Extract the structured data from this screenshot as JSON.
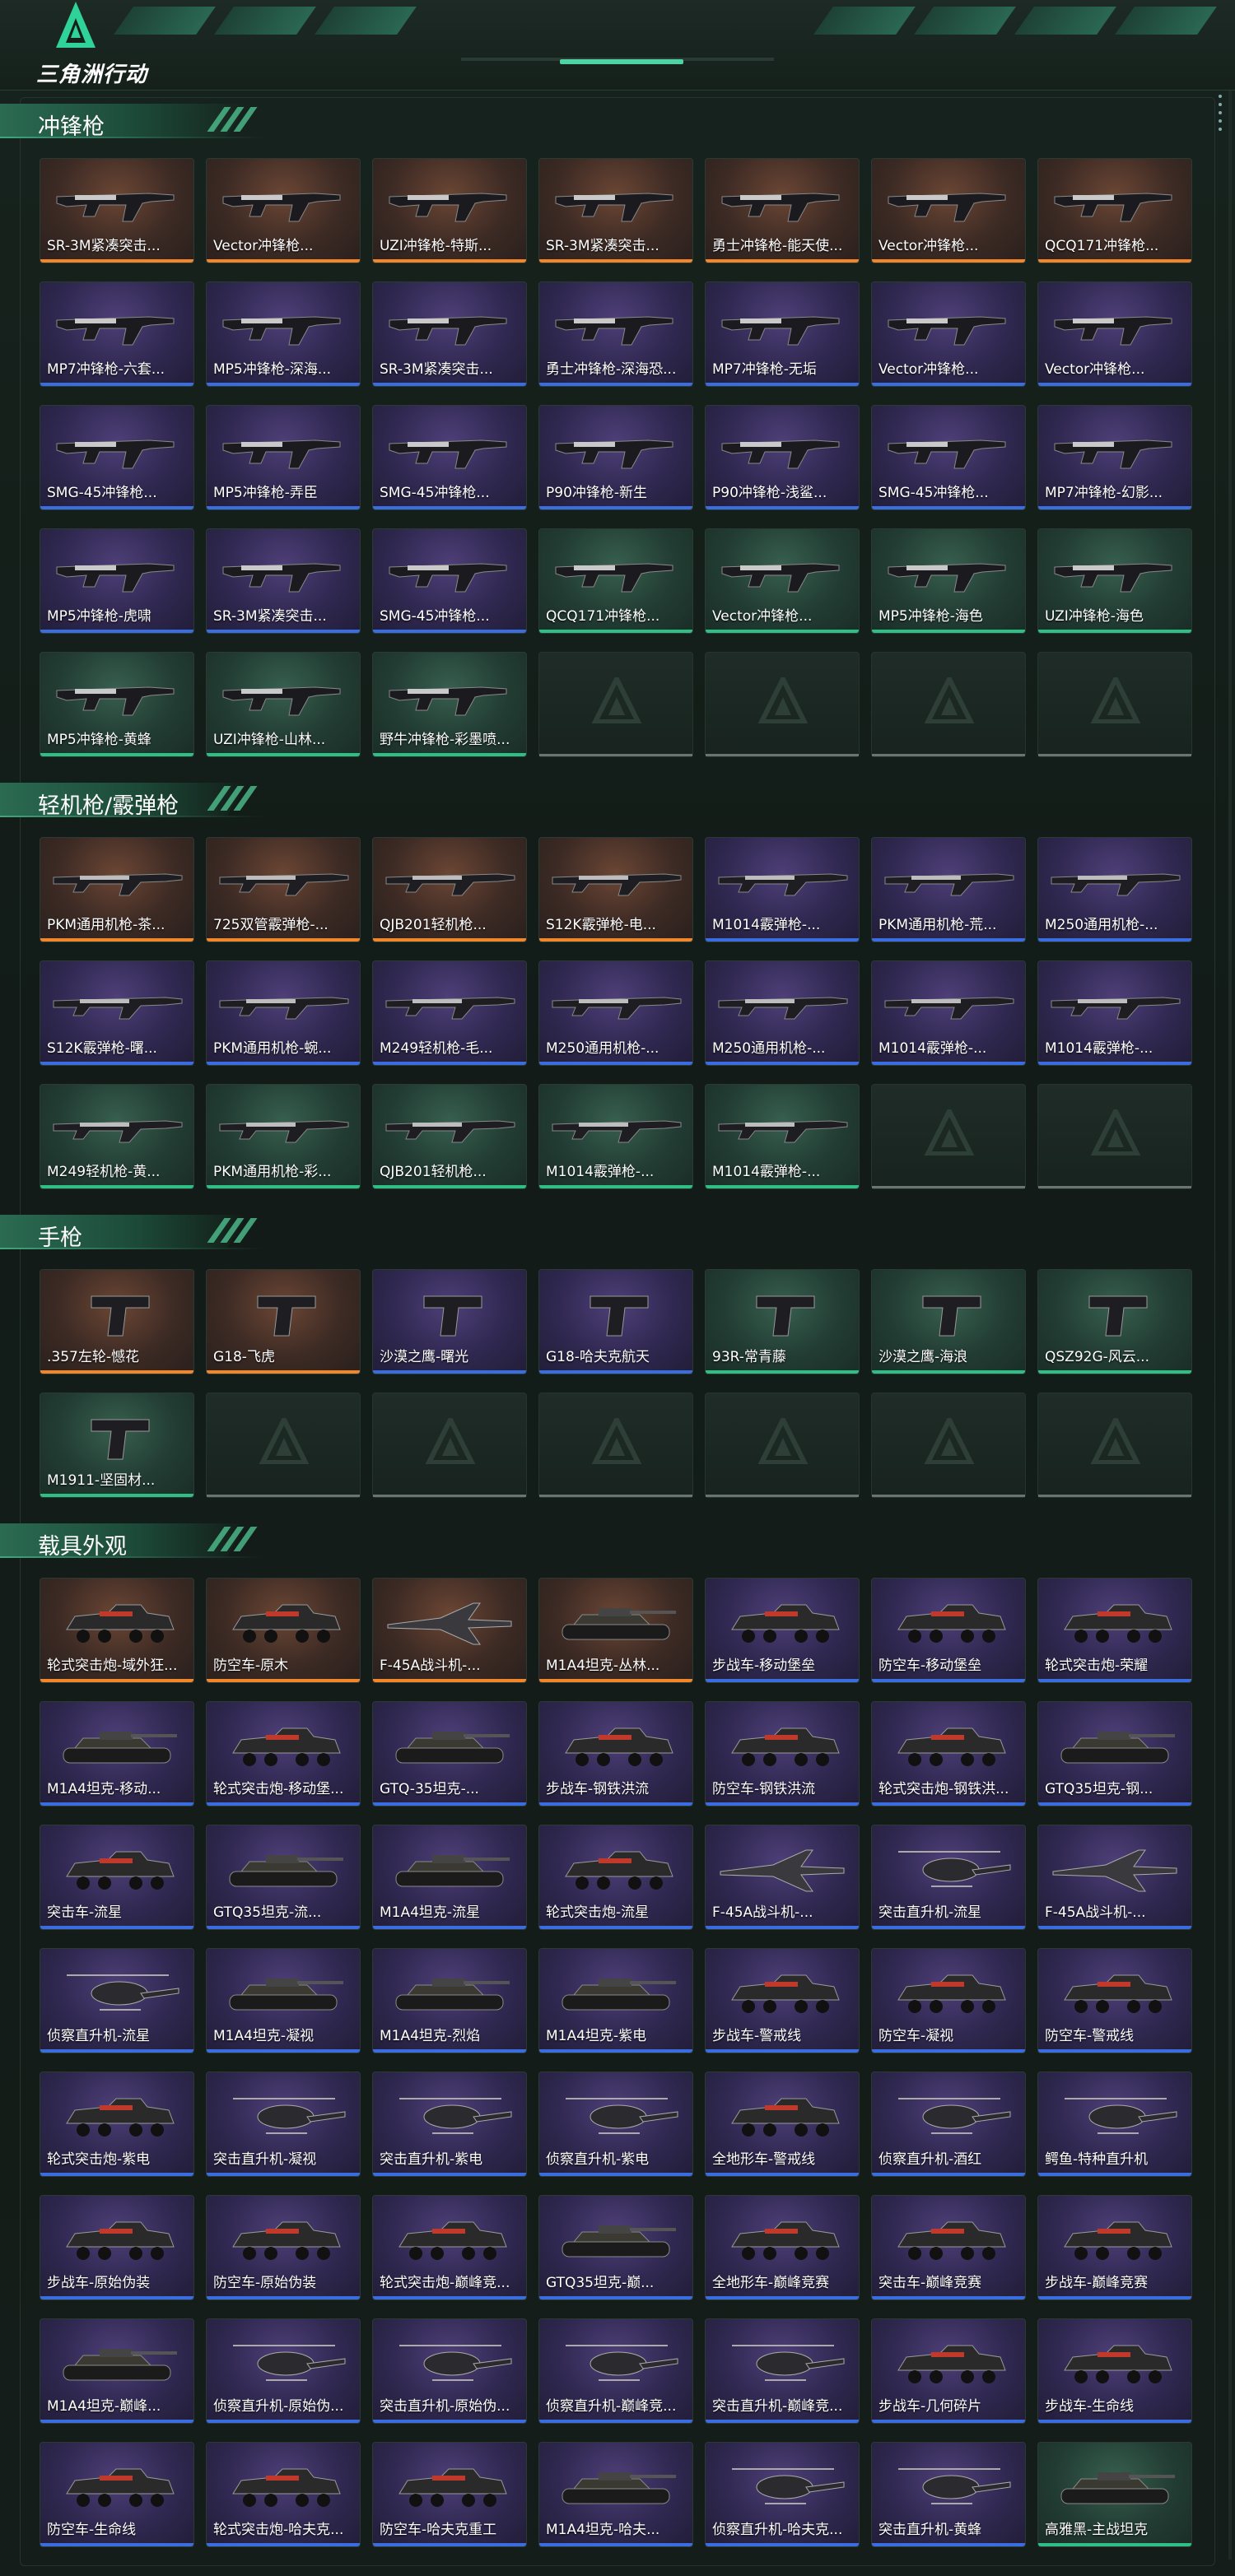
{
  "header": {
    "logo_text": "三角洲行动"
  },
  "colors": {
    "rarity_orange": "#f2862b",
    "rarity_purple": "#3a6de0",
    "rarity_green": "#2fbf86",
    "accent": "#4fd3a3"
  },
  "sections": [
    {
      "title": "冲锋枪",
      "items": [
        {
          "label": "SR-3M紧凑突击...",
          "rarity": "orange",
          "kind": "smg"
        },
        {
          "label": "Vector冲锋枪...",
          "rarity": "orange",
          "kind": "smg"
        },
        {
          "label": "UZI冲锋枪-特斯...",
          "rarity": "orange",
          "kind": "smg"
        },
        {
          "label": "SR-3M紧凑突击...",
          "rarity": "orange",
          "kind": "smg"
        },
        {
          "label": "勇士冲锋枪-能天使...",
          "rarity": "orange",
          "kind": "smg"
        },
        {
          "label": "Vector冲锋枪...",
          "rarity": "orange",
          "kind": "smg"
        },
        {
          "label": "QCQ171冲锋枪...",
          "rarity": "orange",
          "kind": "smg"
        },
        {
          "label": "MP7冲锋枪-六套...",
          "rarity": "purple",
          "kind": "smg"
        },
        {
          "label": "MP5冲锋枪-深海...",
          "rarity": "purple",
          "kind": "smg"
        },
        {
          "label": "SR-3M紧凑突击...",
          "rarity": "purple",
          "kind": "smg"
        },
        {
          "label": "勇士冲锋枪-深海恐...",
          "rarity": "purple",
          "kind": "smg"
        },
        {
          "label": "MP7冲锋枪-无垢",
          "rarity": "purple",
          "kind": "smg"
        },
        {
          "label": "Vector冲锋枪...",
          "rarity": "purple",
          "kind": "smg"
        },
        {
          "label": "Vector冲锋枪...",
          "rarity": "purple",
          "kind": "smg"
        },
        {
          "label": "SMG-45冲锋枪...",
          "rarity": "purple",
          "kind": "smg"
        },
        {
          "label": "MP5冲锋枪-弄臣",
          "rarity": "purple",
          "kind": "smg"
        },
        {
          "label": "SMG-45冲锋枪...",
          "rarity": "purple",
          "kind": "smg"
        },
        {
          "label": "P90冲锋枪-新生",
          "rarity": "purple",
          "kind": "smg"
        },
        {
          "label": "P90冲锋枪-浅鲨...",
          "rarity": "purple",
          "kind": "smg"
        },
        {
          "label": "SMG-45冲锋枪...",
          "rarity": "purple",
          "kind": "smg"
        },
        {
          "label": "MP7冲锋枪-幻影...",
          "rarity": "purple",
          "kind": "smg"
        },
        {
          "label": "MP5冲锋枪-虎啸",
          "rarity": "purple",
          "kind": "smg"
        },
        {
          "label": "SR-3M紧凑突击...",
          "rarity": "purple",
          "kind": "smg"
        },
        {
          "label": "SMG-45冲锋枪...",
          "rarity": "purple",
          "kind": "smg"
        },
        {
          "label": "QCQ171冲锋枪...",
          "rarity": "green",
          "kind": "smg"
        },
        {
          "label": "Vector冲锋枪...",
          "rarity": "green",
          "kind": "smg"
        },
        {
          "label": "MP5冲锋枪-海色",
          "rarity": "green",
          "kind": "smg"
        },
        {
          "label": "UZI冲锋枪-海色",
          "rarity": "green",
          "kind": "smg"
        },
        {
          "label": "MP5冲锋枪-黄蜂",
          "rarity": "green",
          "kind": "smg"
        },
        {
          "label": "UZI冲锋枪-山林...",
          "rarity": "green",
          "kind": "smg"
        },
        {
          "label": "野牛冲锋枪-彩墨喷...",
          "rarity": "green",
          "kind": "smg"
        }
      ],
      "total_slots": 35
    },
    {
      "title": "轻机枪/霰弹枪",
      "items": [
        {
          "label": "PKM通用机枪-茶...",
          "rarity": "orange",
          "kind": "lmg"
        },
        {
          "label": "725双管霰弹枪-...",
          "rarity": "orange",
          "kind": "lmg"
        },
        {
          "label": "QJB201轻机枪...",
          "rarity": "orange",
          "kind": "lmg"
        },
        {
          "label": "S12K霰弹枪-电...",
          "rarity": "orange",
          "kind": "lmg"
        },
        {
          "label": "M1014霰弹枪-...",
          "rarity": "purple",
          "kind": "lmg"
        },
        {
          "label": "PKM通用机枪-荒...",
          "rarity": "purple",
          "kind": "lmg"
        },
        {
          "label": "M250通用机枪-...",
          "rarity": "purple",
          "kind": "lmg"
        },
        {
          "label": "S12K霰弹枪-曙...",
          "rarity": "purple",
          "kind": "lmg"
        },
        {
          "label": "PKM通用机枪-蜿...",
          "rarity": "purple",
          "kind": "lmg"
        },
        {
          "label": "M249轻机枪-毛...",
          "rarity": "purple",
          "kind": "lmg"
        },
        {
          "label": "M250通用机枪-...",
          "rarity": "purple",
          "kind": "lmg"
        },
        {
          "label": "M250通用机枪-...",
          "rarity": "purple",
          "kind": "lmg"
        },
        {
          "label": "M1014霰弹枪-...",
          "rarity": "purple",
          "kind": "lmg"
        },
        {
          "label": "M1014霰弹枪-...",
          "rarity": "purple",
          "kind": "lmg"
        },
        {
          "label": "M249轻机枪-黄...",
          "rarity": "green",
          "kind": "lmg"
        },
        {
          "label": "PKM通用机枪-彩...",
          "rarity": "green",
          "kind": "lmg"
        },
        {
          "label": "QJB201轻机枪...",
          "rarity": "green",
          "kind": "lmg"
        },
        {
          "label": "M1014霰弹枪-...",
          "rarity": "green",
          "kind": "lmg"
        },
        {
          "label": "M1014霰弹枪-...",
          "rarity": "green",
          "kind": "lmg"
        }
      ],
      "total_slots": 21
    },
    {
      "title": "手枪",
      "items": [
        {
          "label": ".357左轮-憾花",
          "rarity": "orange",
          "kind": "pistol"
        },
        {
          "label": "G18-飞虎",
          "rarity": "orange",
          "kind": "pistol"
        },
        {
          "label": "沙漠之鹰-曙光",
          "rarity": "purple",
          "kind": "pistol"
        },
        {
          "label": "G18-哈夫克航天",
          "rarity": "purple",
          "kind": "pistol"
        },
        {
          "label": "93R-常青藤",
          "rarity": "green",
          "kind": "pistol"
        },
        {
          "label": "沙漠之鹰-海浪",
          "rarity": "green",
          "kind": "pistol"
        },
        {
          "label": "QSZ92G-风云...",
          "rarity": "green",
          "kind": "pistol"
        },
        {
          "label": "M1911-坚固材...",
          "rarity": "green",
          "kind": "pistol"
        }
      ],
      "total_slots": 14
    },
    {
      "title": "载具外观",
      "items": [
        {
          "label": "轮式突击炮-域外狂...",
          "rarity": "orange",
          "kind": "vehicle"
        },
        {
          "label": "防空车-原木",
          "rarity": "orange",
          "kind": "vehicle"
        },
        {
          "label": "F-45A战斗机-...",
          "rarity": "orange",
          "kind": "jet"
        },
        {
          "label": "M1A4坦克-丛林...",
          "rarity": "orange",
          "kind": "tank"
        },
        {
          "label": "步战车-移动堡垒",
          "rarity": "purple",
          "kind": "vehicle"
        },
        {
          "label": "防空车-移动堡垒",
          "rarity": "purple",
          "kind": "vehicle"
        },
        {
          "label": "轮式突击炮-荣耀",
          "rarity": "purple",
          "kind": "vehicle"
        },
        {
          "label": "M1A4坦克-移动...",
          "rarity": "purple",
          "kind": "tank"
        },
        {
          "label": "轮式突击炮-移动堡...",
          "rarity": "purple",
          "kind": "vehicle"
        },
        {
          "label": "GTQ-35坦克-...",
          "rarity": "purple",
          "kind": "tank"
        },
        {
          "label": "步战车-钢铁洪流",
          "rarity": "purple",
          "kind": "vehicle"
        },
        {
          "label": "防空车-钢铁洪流",
          "rarity": "purple",
          "kind": "vehicle"
        },
        {
          "label": "轮式突击炮-钢铁洪...",
          "rarity": "purple",
          "kind": "vehicle"
        },
        {
          "label": "GTQ35坦克-钢...",
          "rarity": "purple",
          "kind": "tank"
        },
        {
          "label": "突击车-流星",
          "rarity": "purple",
          "kind": "vehicle"
        },
        {
          "label": "GTQ35坦克-流...",
          "rarity": "purple",
          "kind": "tank"
        },
        {
          "label": "M1A4坦克-流星",
          "rarity": "purple",
          "kind": "tank"
        },
        {
          "label": "轮式突击炮-流星",
          "rarity": "purple",
          "kind": "vehicle"
        },
        {
          "label": "F-45A战斗机-...",
          "rarity": "purple",
          "kind": "jet"
        },
        {
          "label": "突击直升机-流星",
          "rarity": "purple",
          "kind": "heli"
        },
        {
          "label": "F-45A战斗机-...",
          "rarity": "purple",
          "kind": "jet"
        },
        {
          "label": "侦察直升机-流星",
          "rarity": "purple",
          "kind": "heli"
        },
        {
          "label": "M1A4坦克-凝视",
          "rarity": "purple",
          "kind": "tank"
        },
        {
          "label": "M1A4坦克-烈焰",
          "rarity": "purple",
          "kind": "tank"
        },
        {
          "label": "M1A4坦克-紫电",
          "rarity": "purple",
          "kind": "tank"
        },
        {
          "label": "步战车-警戒线",
          "rarity": "purple",
          "kind": "vehicle"
        },
        {
          "label": "防空车-凝视",
          "rarity": "purple",
          "kind": "vehicle"
        },
        {
          "label": "防空车-警戒线",
          "rarity": "purple",
          "kind": "vehicle"
        },
        {
          "label": "轮式突击炮-紫电",
          "rarity": "purple",
          "kind": "vehicle"
        },
        {
          "label": "突击直升机-凝视",
          "rarity": "purple",
          "kind": "heli"
        },
        {
          "label": "突击直升机-紫电",
          "rarity": "purple",
          "kind": "heli"
        },
        {
          "label": "侦察直升机-紫电",
          "rarity": "purple",
          "kind": "heli"
        },
        {
          "label": "全地形车-警戒线",
          "rarity": "purple",
          "kind": "vehicle"
        },
        {
          "label": "侦察直升机-酒红",
          "rarity": "purple",
          "kind": "heli"
        },
        {
          "label": "鳄鱼-特种直升机",
          "rarity": "purple",
          "kind": "heli"
        },
        {
          "label": "步战车-原始伪装",
          "rarity": "purple",
          "kind": "vehicle"
        },
        {
          "label": "防空车-原始伪装",
          "rarity": "purple",
          "kind": "vehicle"
        },
        {
          "label": "轮式突击炮-巅峰竞...",
          "rarity": "purple",
          "kind": "vehicle"
        },
        {
          "label": "GTQ35坦克-巅...",
          "rarity": "purple",
          "kind": "tank"
        },
        {
          "label": "全地形车-巅峰竞赛",
          "rarity": "purple",
          "kind": "vehicle"
        },
        {
          "label": "突击车-巅峰竞赛",
          "rarity": "purple",
          "kind": "vehicle"
        },
        {
          "label": "步战车-巅峰竞赛",
          "rarity": "purple",
          "kind": "vehicle"
        },
        {
          "label": "M1A4坦克-巅峰...",
          "rarity": "purple",
          "kind": "tank"
        },
        {
          "label": "侦察直升机-原始伪...",
          "rarity": "purple",
          "kind": "heli"
        },
        {
          "label": "突击直升机-原始伪...",
          "rarity": "purple",
          "kind": "heli"
        },
        {
          "label": "侦察直升机-巅峰竞...",
          "rarity": "purple",
          "kind": "heli"
        },
        {
          "label": "突击直升机-巅峰竞...",
          "rarity": "purple",
          "kind": "heli"
        },
        {
          "label": "步战车-几何碎片",
          "rarity": "purple",
          "kind": "vehicle"
        },
        {
          "label": "步战车-生命线",
          "rarity": "purple",
          "kind": "vehicle"
        },
        {
          "label": "防空车-生命线",
          "rarity": "purple",
          "kind": "vehicle"
        },
        {
          "label": "轮式突击炮-哈夫克...",
          "rarity": "purple",
          "kind": "vehicle"
        },
        {
          "label": "防空车-哈夫克重工",
          "rarity": "purple",
          "kind": "vehicle"
        },
        {
          "label": "M1A4坦克-哈夫...",
          "rarity": "purple",
          "kind": "tank"
        },
        {
          "label": "侦察直升机-哈夫克...",
          "rarity": "purple",
          "kind": "heli"
        },
        {
          "label": "突击直升机-黄蜂",
          "rarity": "purple",
          "kind": "heli"
        },
        {
          "label": "高雅黑-主战坦克",
          "rarity": "green",
          "kind": "tank"
        }
      ],
      "total_slots": 56
    }
  ]
}
